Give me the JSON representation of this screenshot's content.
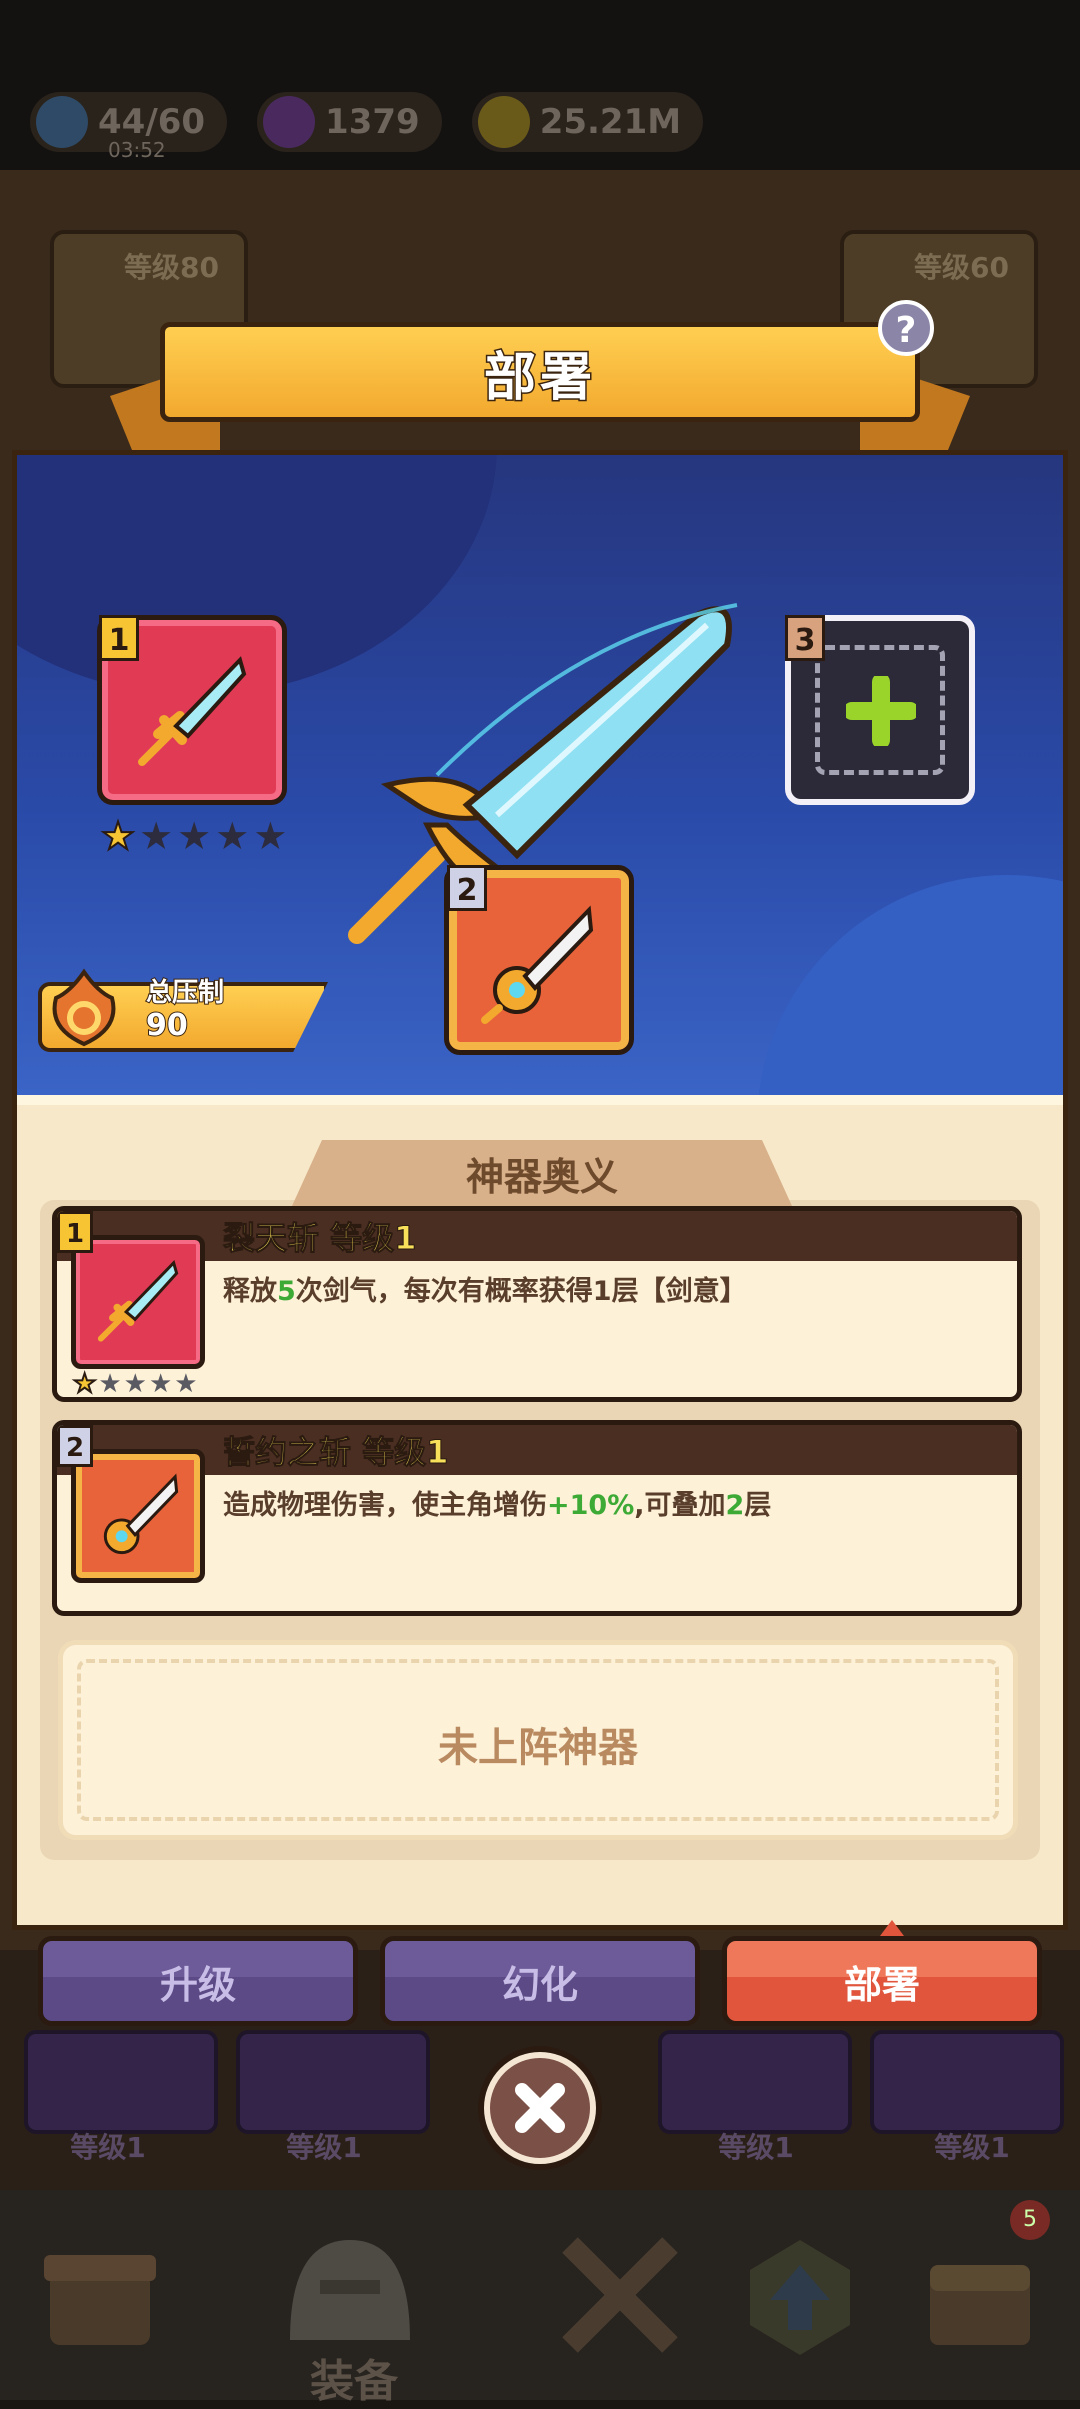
{
  "resources": {
    "energy": "44/60",
    "energy_timer": "03:52",
    "gems": "1379",
    "gold": "25.21M"
  },
  "background": {
    "left_level": "等级80",
    "right_level": "等级60",
    "slot_level": "等级1",
    "nav_selected_label": "装备",
    "nav_badge": "5"
  },
  "dialog": {
    "title": "部署",
    "help_symbol": "?",
    "total_power_label": "总压制",
    "total_power_value": "90"
  },
  "slots": [
    {
      "number": "1",
      "stars_filled": 1,
      "stars_total": 5
    },
    {
      "number": "2"
    },
    {
      "number": "3",
      "state": "empty"
    }
  ],
  "skills_section": {
    "title": "神器奥义",
    "skills": [
      {
        "number": "1",
        "name": "裂天斩 等级1",
        "desc_parts": [
          "释放",
          "5",
          "次剑气，每次有概率获得1层【剑意】"
        ],
        "stars_filled": 1,
        "stars_total": 5
      },
      {
        "number": "2",
        "name": "誓约之斩 等级1",
        "desc_parts": [
          "造成物理伤害，使主角增伤",
          "+10%",
          ",可叠加",
          "2",
          "层"
        ]
      }
    ],
    "empty_label": "未上阵神器"
  },
  "buttons": {
    "upgrade": "升级",
    "transform": "幻化",
    "deploy": "部署"
  },
  "colors": {
    "ribbon": "#f2a92e",
    "scene": "#2a4aa8",
    "deploy_button": "#e0553c",
    "purple_button": "#6c5b98",
    "highlight_green": "#3eaa36"
  }
}
